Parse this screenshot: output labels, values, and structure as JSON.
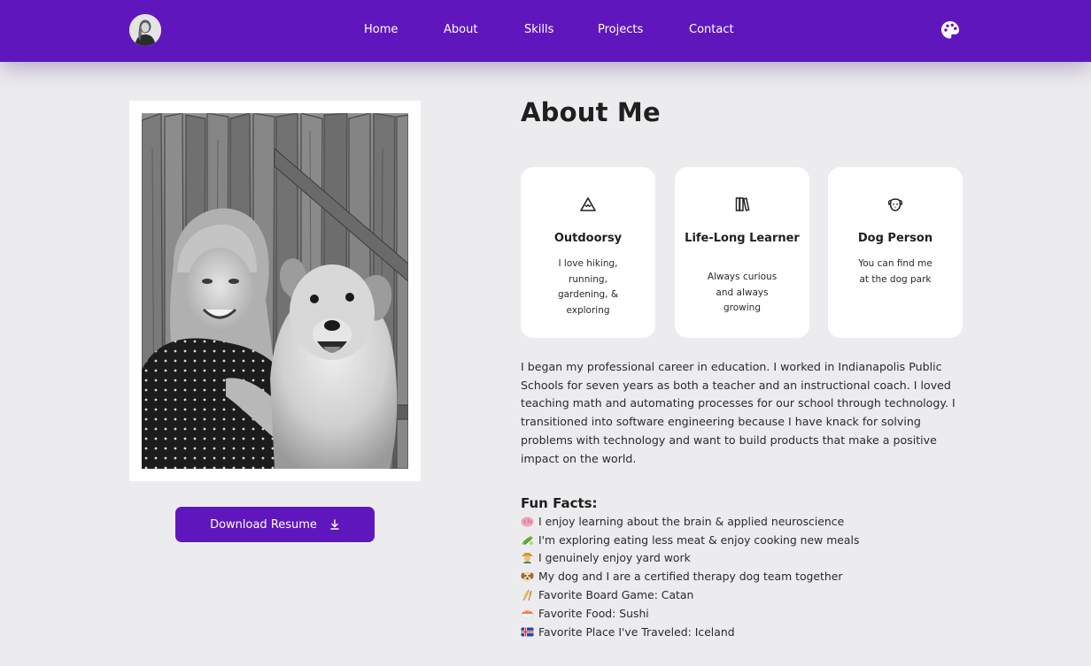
{
  "nav": {
    "links": [
      "Home",
      "About",
      "Skills",
      "Projects",
      "Contact"
    ],
    "avatar_icon": "profile-avatar",
    "theme_icon": "palette-icon"
  },
  "about": {
    "title": "About Me",
    "resume_button": "Download Resume",
    "cards": [
      {
        "icon": "mountain-icon",
        "title": "Outdoorsy",
        "text": "I love hiking, running, gardening, & exploring"
      },
      {
        "icon": "books-icon",
        "title": "Life-Long Learner",
        "text": "Always curious and always growing"
      },
      {
        "icon": "dog-icon",
        "title": "Dog Person",
        "text": "You can find me at the dog park"
      }
    ],
    "bio": "I began my professional career in education. I worked in Indianapolis Public Schools for seven years as both a teacher and an instructional coach. I loved teaching math and automating processes for our school through technology. I transitioned into software engineering because I have knack for solving problems with technology and want to build products that make a positive impact on the world.",
    "fun_facts_title": "Fun Facts:",
    "fun_facts": [
      {
        "emoji": "brain-emoji",
        "text": "I enjoy learning about the brain & applied neuroscience"
      },
      {
        "emoji": "salad-emoji",
        "text": "I'm exploring eating less meat & enjoy cooking new meals"
      },
      {
        "emoji": "farmer-emoji",
        "text": "I genuinely enjoy yard work"
      },
      {
        "emoji": "dog-face-emoji",
        "text": "My dog and I are a certified therapy dog team together"
      },
      {
        "emoji": "wheat-emoji",
        "text": "Favorite Board Game: Catan"
      },
      {
        "emoji": "sushi-emoji",
        "text": "Favorite Food: Sushi"
      },
      {
        "emoji": "iceland-flag-emoji",
        "text": "Favorite Place I've Traveled: Iceland"
      }
    ]
  },
  "colors": {
    "brand": "#5f17bd",
    "background": "#ececef",
    "card": "#ffffff"
  }
}
